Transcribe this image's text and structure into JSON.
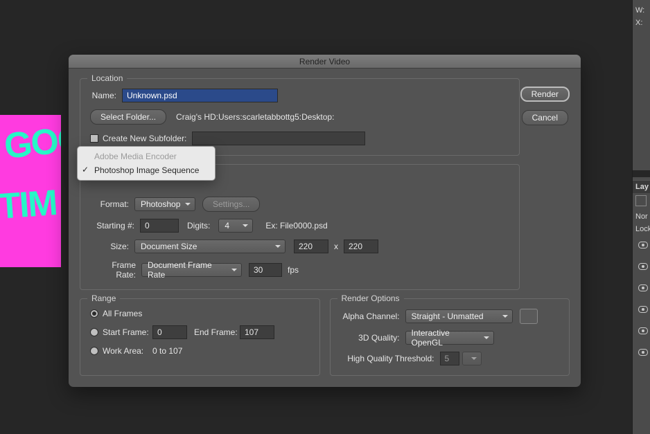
{
  "dialog": {
    "title": "Render Video",
    "action_primary": "Render",
    "action_secondary": "Cancel"
  },
  "location": {
    "legend": "Location",
    "name_label": "Name:",
    "name_value": "Unknown.psd",
    "select_folder": "Select Folder...",
    "path": "Craig's HD:Users:scarletabbottg5:Desktop:",
    "create_subfolder_label": "Create New Subfolder:",
    "subfolder_value": ""
  },
  "encoder_popup": {
    "option_disabled": "Adobe Media Encoder",
    "option_selected": "Photoshop Image Sequence",
    "checkmark": "✓"
  },
  "image_seq": {
    "format_label": "Format:",
    "format_value": "Photoshop",
    "settings_btn": "Settings...",
    "starting_label": "Starting #:",
    "starting_value": "0",
    "digits_label": "Digits:",
    "digits_value": "4",
    "example": "Ex: File0000.psd",
    "size_label": "Size:",
    "size_preset": "Document Size",
    "width": "220",
    "x": "x",
    "height": "220",
    "framerate_label": "Frame Rate:",
    "framerate_preset": "Document Frame Rate",
    "framerate_value": "30",
    "framerate_unit": "fps"
  },
  "range": {
    "legend": "Range",
    "all_frames": "All Frames",
    "start_frame_label": "Start Frame:",
    "start_frame_value": "0",
    "end_frame_label": "End Frame:",
    "end_frame_value": "107",
    "work_area_label": "Work Area:",
    "work_area_value": "0 to 107"
  },
  "render_opts": {
    "legend": "Render Options",
    "alpha_label": "Alpha Channel:",
    "alpha_value": "Straight - Unmatted",
    "quality_label": "3D Quality:",
    "quality_value": "Interactive OpenGL",
    "hqt_label": "High Quality Threshold:",
    "hqt_value": "5"
  },
  "right": {
    "w": "W:",
    "x": "X:",
    "layers": "Lay",
    "kind_filter": "Nor",
    "lock_label": "Lock"
  },
  "bg_art": {
    "line1": "GOO",
    "line2": "TIM"
  }
}
